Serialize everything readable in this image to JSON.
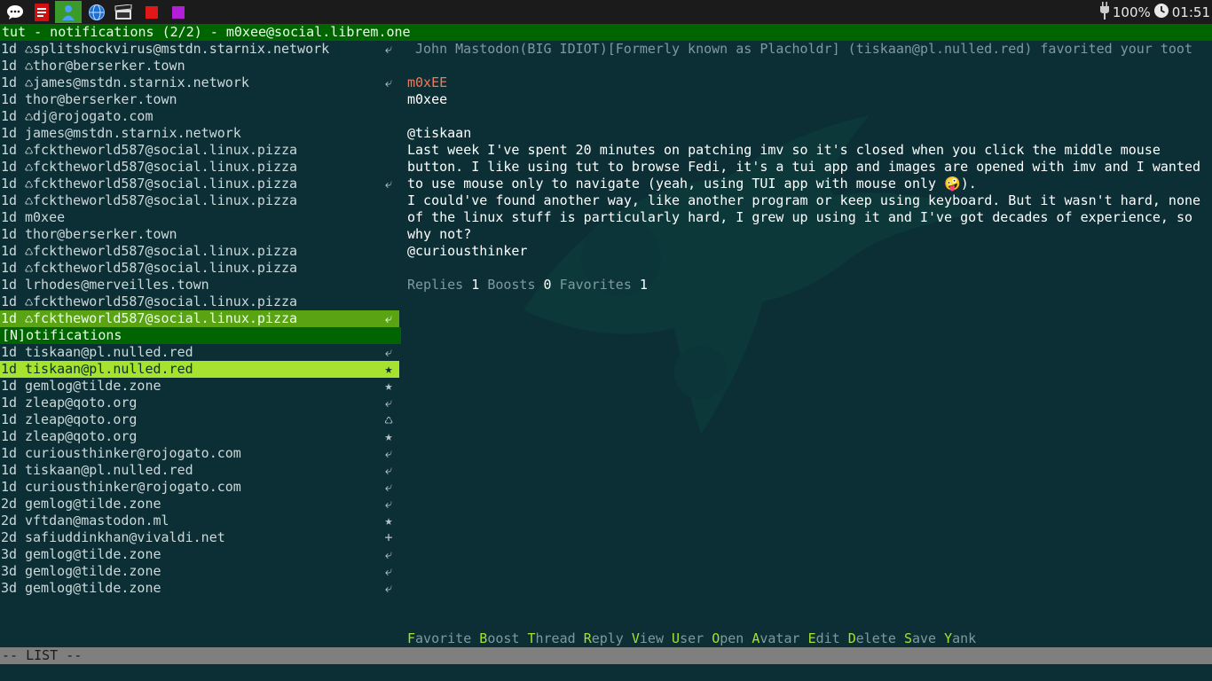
{
  "topbar": {
    "battery": "100%",
    "clock": "01:51"
  },
  "window": {
    "title": "tut - notifications (2/2) - m0xee@social.librem.one"
  },
  "left": {
    "upper_items": [
      {
        "age": "1d",
        "boost": true,
        "account": "splitshockvirus@mstdn.starnix.network",
        "icon": "reply"
      },
      {
        "age": "1d",
        "boost": true,
        "account": "thor@berserker.town",
        "icon": ""
      },
      {
        "age": "1d",
        "boost": true,
        "account": "james@mstdn.starnix.network",
        "icon": "reply"
      },
      {
        "age": "1d",
        "boost": false,
        "account": "thor@berserker.town",
        "icon": ""
      },
      {
        "age": "1d",
        "boost": true,
        "account": "dj@rojogato.com",
        "icon": ""
      },
      {
        "age": "1d",
        "boost": false,
        "account": "james@mstdn.starnix.network",
        "icon": ""
      },
      {
        "age": "1d",
        "boost": true,
        "account": "fcktheworld587@social.linux.pizza",
        "icon": ""
      },
      {
        "age": "1d",
        "boost": true,
        "account": "fcktheworld587@social.linux.pizza",
        "icon": ""
      },
      {
        "age": "1d",
        "boost": true,
        "account": "fcktheworld587@social.linux.pizza",
        "icon": "reply"
      },
      {
        "age": "1d",
        "boost": true,
        "account": "fcktheworld587@social.linux.pizza",
        "icon": ""
      },
      {
        "age": "1d",
        "boost": false,
        "account": "m0xee",
        "icon": ""
      },
      {
        "age": "1d",
        "boost": false,
        "account": "thor@berserker.town",
        "icon": ""
      },
      {
        "age": "1d",
        "boost": true,
        "account": "fcktheworld587@social.linux.pizza",
        "icon": ""
      },
      {
        "age": "1d",
        "boost": true,
        "account": "fcktheworld587@social.linux.pizza",
        "icon": ""
      },
      {
        "age": "1d",
        "boost": false,
        "account": "lrhodes@merveilles.town",
        "icon": ""
      },
      {
        "age": "1d",
        "boost": true,
        "account": "fcktheworld587@social.linux.pizza",
        "icon": ""
      },
      {
        "age": "1d",
        "boost": true,
        "account": "fcktheworld587@social.linux.pizza",
        "icon": "reply",
        "selected": true
      }
    ],
    "header": "[N]otifications",
    "notif_items": [
      {
        "age": "1d",
        "account": "tiskaan@pl.nulled.red",
        "icon": "reply"
      },
      {
        "age": "1d",
        "account": "tiskaan@pl.nulled.red",
        "icon": "star",
        "selected": true
      },
      {
        "age": "1d",
        "account": "gemlog@tilde.zone",
        "icon": "star"
      },
      {
        "age": "1d",
        "account": "zleap@qoto.org",
        "icon": "reply"
      },
      {
        "age": "1d",
        "account": "zleap@qoto.org",
        "icon": "boost"
      },
      {
        "age": "1d",
        "account": "zleap@qoto.org",
        "icon": "star"
      },
      {
        "age": "1d",
        "account": "curiousthinker@rojogato.com",
        "icon": "reply"
      },
      {
        "age": "1d",
        "account": "tiskaan@pl.nulled.red",
        "icon": "reply"
      },
      {
        "age": "1d",
        "account": "curiousthinker@rojogato.com",
        "icon": "reply"
      },
      {
        "age": "2d",
        "account": "gemlog@tilde.zone",
        "icon": "reply"
      },
      {
        "age": "2d",
        "account": "vftdan@mastodon.ml",
        "icon": "star"
      },
      {
        "age": "2d",
        "account": "safiuddinkhan@vivaldi.net",
        "icon": "follow"
      },
      {
        "age": "3d",
        "account": "gemlog@tilde.zone",
        "icon": "reply"
      },
      {
        "age": "3d",
        "account": "gemlog@tilde.zone",
        "icon": "reply"
      },
      {
        "age": "3d",
        "account": "gemlog@tilde.zone",
        "icon": "reply"
      }
    ]
  },
  "icons": {
    "reply": "⤶",
    "star": "★",
    "boost": "♺",
    "follow": "+"
  },
  "toot": {
    "notification": "John Mastodon(BIG IDIOT)[Formerly known as Placholdr] (tiskaan@pl.nulled.red) favorited your toot",
    "display_name": "m0xEE",
    "username": "m0xee",
    "mention": "@tiskaan",
    "body_lines": [
      "Last week I've spent 20 minutes on patching imv so it's closed when you click the middle mouse",
      "button. I like using tut to browse Fedi, it's a tui app and images are opened with imv and I wanted",
      "to use mouse only to navigate (yeah, using TUI app with mouse only 🤪).",
      "I could've found another way, like another program or keep using keyboard. But it wasn't hard, none",
      "of the linux stuff is particularly hard, I grew up using it and I've got decades of experience, so",
      "why not?",
      "@curiousthinker"
    ],
    "stats": {
      "replies_label": "Replies",
      "replies": "1",
      "boosts_label": "Boosts",
      "boosts": "0",
      "favorites_label": "Favorites",
      "favorites": "1"
    }
  },
  "actions": [
    {
      "key": "F",
      "rest": "avorite"
    },
    {
      "key": "B",
      "rest": "oost"
    },
    {
      "key": "T",
      "rest": "hread"
    },
    {
      "key": "R",
      "rest": "eply"
    },
    {
      "key": "V",
      "rest": "iew"
    },
    {
      "key": "U",
      "rest": "ser"
    },
    {
      "key": "O",
      "rest": "pen"
    },
    {
      "key": "A",
      "rest": "vatar"
    },
    {
      "key": "E",
      "rest": "dit"
    },
    {
      "key": "D",
      "rest": "elete"
    },
    {
      "key": "S",
      "rest": "ave"
    },
    {
      "key": "Y",
      "rest": "ank"
    }
  ],
  "status": "-- LIST --"
}
